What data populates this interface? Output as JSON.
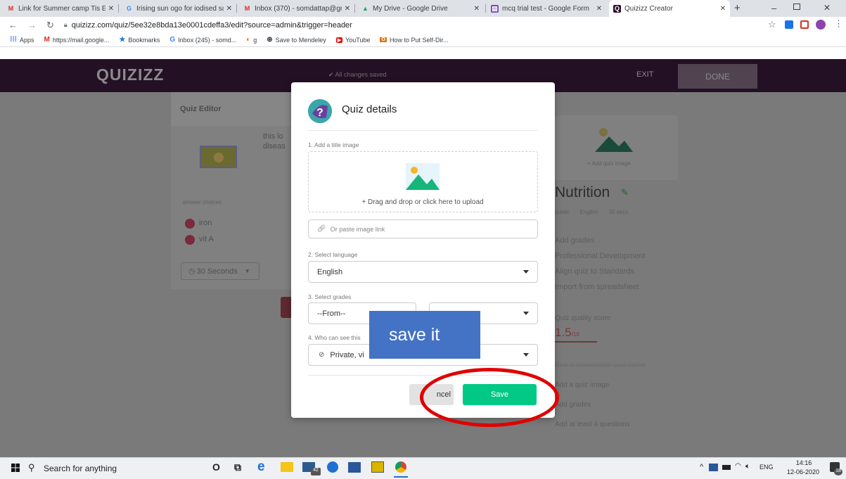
{
  "browser": {
    "tabs": [
      {
        "title": "Link for Summer camp Tis Ec",
        "icon": "gmail-icon",
        "favtext": "M",
        "favcolor": "#d93025"
      },
      {
        "title": "Irising sun ogo for iodised sa",
        "icon": "google-icon",
        "favtext": "G",
        "favcolor": "#4285f4"
      },
      {
        "title": "Inbox (370) - somdattap@gm",
        "icon": "gmail-icon",
        "favtext": "M",
        "favcolor": "#d93025"
      },
      {
        "title": "My Drive - Google Drive",
        "icon": "drive-icon",
        "favtext": "▲",
        "favcolor": "#1fa463"
      },
      {
        "title": "mcq trial test - Google Form",
        "icon": "forms-icon",
        "favtext": "▤",
        "favcolor": "#7248b9"
      },
      {
        "title": "Quizizz Creator",
        "icon": "quizizz-icon",
        "favtext": "Q",
        "favcolor": "#2c0e2b"
      }
    ],
    "url": "quizizz.com/quiz/5ee32e8bda13e0001cdeffa3/edit?source=admin&trigger=header",
    "bookmarks": [
      {
        "label": "Apps",
        "icon": "apps-icon"
      },
      {
        "label": "https://mail.google...",
        "icon": "gmail-icon"
      },
      {
        "label": "Bookmarks",
        "icon": "star-icon"
      },
      {
        "label": "Inbox (245) - somd...",
        "icon": "google-icon"
      },
      {
        "label": "g",
        "icon": "colorful-icon"
      },
      {
        "label": "Save to Mendeley",
        "icon": "mendeley-icon"
      },
      {
        "label": "YouTube",
        "icon": "youtube-icon"
      },
      {
        "label": "How to Put Self-Dir...",
        "icon": "office-icon"
      }
    ]
  },
  "quizizz": {
    "logo": "QUIZIZZ",
    "saved_status": "✔ All changes saved",
    "exit": "EXIT",
    "done": "DONE",
    "editor_title": "Quiz Editor",
    "question_text_1": "this lo",
    "question_text_2": "diseas",
    "answer_choices_label": "answer choices",
    "answers": [
      "iron",
      "vit A"
    ],
    "timer": "30 Seconds",
    "add_quiz_image": "+ Add quiz image",
    "quiz_name": "Nutrition",
    "meta": [
      "public",
      "English",
      "30 secs"
    ],
    "side_options": [
      "Add grades",
      "Professional Development",
      "Align quiz to Standards",
      "Import from spreadsheet"
    ],
    "quality_label": "Quiz quality score",
    "quality_score": "1.5",
    "quality_max": "/10",
    "checklist": [
      "Pick a memorable quiz name",
      "Add a quiz image",
      "Add grades",
      "Add at least 4 questions"
    ]
  },
  "modal": {
    "title": "Quiz details",
    "step1": "1. Add a title image",
    "upload_text": "+ Drag and drop or click here to upload",
    "paste_placeholder": "Or paste image link",
    "step2": "2. Select language",
    "language": "English",
    "step3": "3. Select grades",
    "grade_from": "--From--",
    "step4": "4. Who can see this",
    "visibility": "Private, vi",
    "cancel": "ncel",
    "save": "Save"
  },
  "annotation": {
    "callout": "save it",
    "callout_color": "#4472c4",
    "circle_color": "#e00000"
  },
  "taskbar": {
    "search_placeholder": "Search for anything",
    "mail_badge": "42",
    "lang": "ENG",
    "time": "14:16",
    "date": "12-06-2020",
    "notif_count": "18"
  },
  "colors": {
    "quizizz_header": "#2c0e2b",
    "save_green": "#00c985",
    "overlay": "#7a7a7a"
  }
}
